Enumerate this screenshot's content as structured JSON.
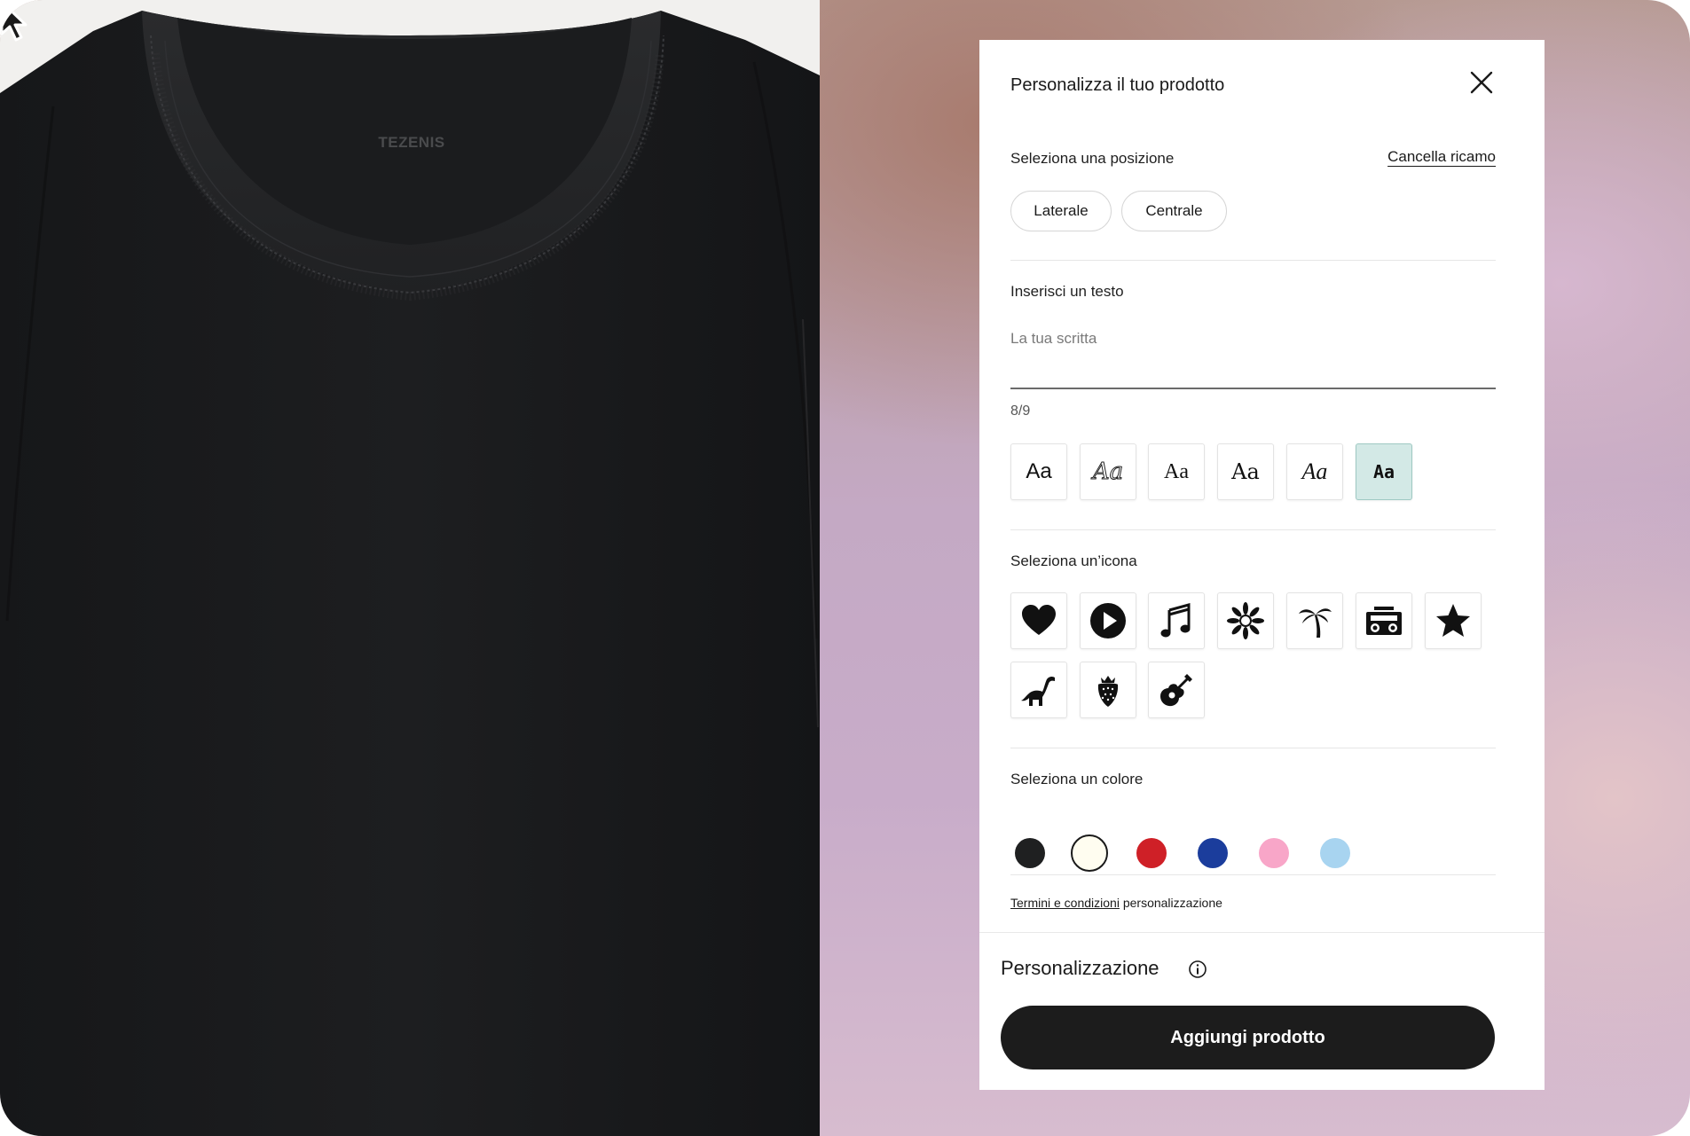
{
  "product_photo": {
    "brand_label": "TEZENIS"
  },
  "panel": {
    "title": "Personalizza il tuo prodotto",
    "position": {
      "label": "Seleziona una posizione",
      "clear_label": "Cancella ricamo",
      "options": [
        "Laterale",
        "Centrale"
      ]
    },
    "text": {
      "label": "Inserisci un testo",
      "placeholder": "La tua scritta",
      "value": "",
      "counter": "8/9"
    },
    "fonts": {
      "options": [
        "Aa",
        "Aa",
        "Aa",
        "Aa",
        "Aa",
        "Aa"
      ],
      "selected_index": 5
    },
    "icons": {
      "label": "Seleziona un’icona",
      "items": [
        "heart-icon",
        "play-icon",
        "music-note-icon",
        "flower-icon",
        "palm-tree-icon",
        "boombox-icon",
        "star-icon",
        "dinosaur-icon",
        "strawberry-icon",
        "guitar-icon"
      ]
    },
    "colors": {
      "label": "Seleziona un colore",
      "swatches": [
        "#1f2021",
        "#fffdf0",
        "#cf2027",
        "#1b3d9c",
        "#f8a6c8",
        "#a8d4f0"
      ],
      "selected_index": 1
    },
    "terms": {
      "link_text": "Termini e condizioni",
      "suffix": " personalizzazione"
    },
    "footer": {
      "title": "Personalizzazione",
      "button_label": "Aggiungi prodotto"
    }
  }
}
